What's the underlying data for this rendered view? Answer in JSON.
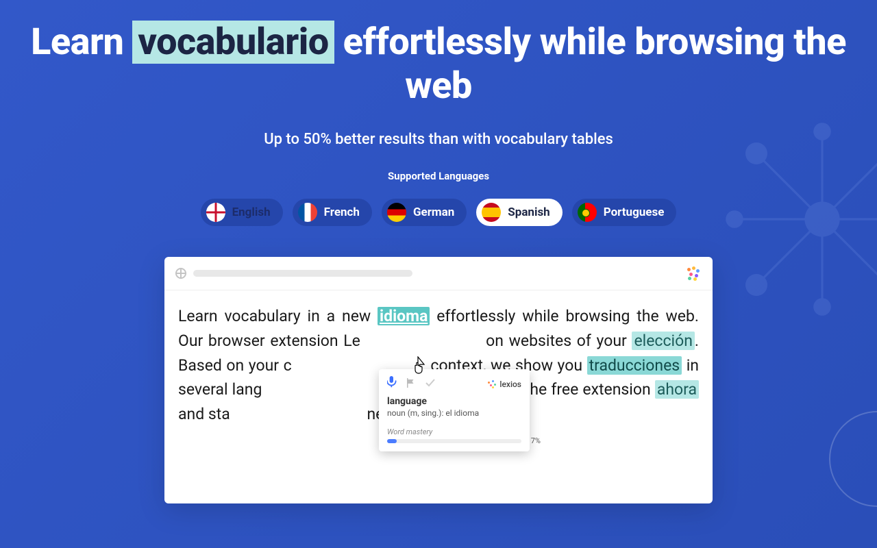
{
  "headline": {
    "pre": "Learn ",
    "highlight": "vocabulario",
    "post": " effortlessly while browsing the web"
  },
  "subhead": "Up to 50% better results than with vocabulary tables",
  "supported_label": "Supported Languages",
  "languages": [
    {
      "label": "English",
      "flag": "uk",
      "state": "dimmed"
    },
    {
      "label": "French",
      "flag": "fr",
      "state": "normal"
    },
    {
      "label": "German",
      "flag": "de",
      "state": "normal"
    },
    {
      "label": "Spanish",
      "flag": "es",
      "state": "active"
    },
    {
      "label": "Portuguese",
      "flag": "pt",
      "state": "normal"
    }
  ],
  "demo": {
    "text_parts": [
      {
        "t": "Learn vocabulary in a new "
      },
      {
        "t": "idioma",
        "hl": "selected"
      },
      {
        "t": " effortlessly while browsing the web. Our browser extension Le"
      },
      {
        "t": "                        on websites of your "
      },
      {
        "t": "elección",
        "hl": "light"
      },
      {
        "t": ". Based on your c"
      },
      {
        "t": "                               context, we show you "
      },
      {
        "t": "traducciones",
        "hl": "hl"
      },
      {
        "t": " in several lang"
      },
      {
        "t": "                            ctive and fun. Install the free extension "
      },
      {
        "t": "ahora",
        "hl": "light"
      },
      {
        "t": " and sta"
      },
      {
        "t": "                                   ney."
      }
    ]
  },
  "tooltip": {
    "brand": "lexios",
    "word": "language",
    "definition": "noun (m, sing.): el idioma",
    "mastery_label": "Word mastery",
    "mastery_pct": "7%",
    "mastery_val": 7
  }
}
